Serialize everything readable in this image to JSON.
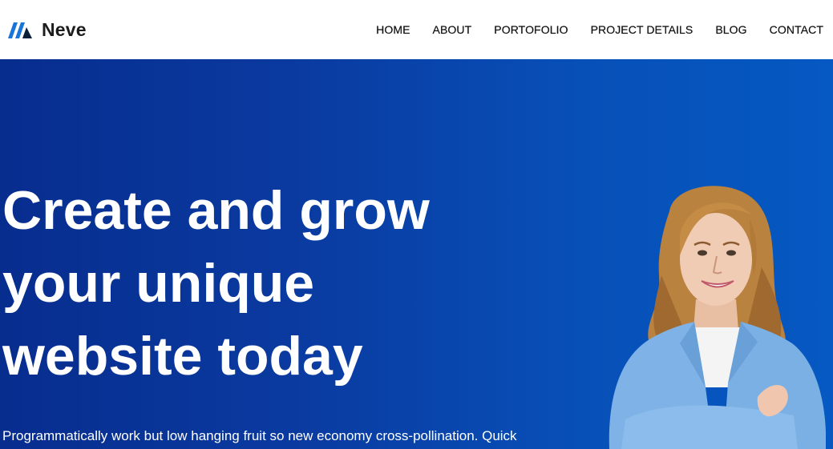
{
  "brand": {
    "name": "Neve",
    "logo_icon": "neve-logo-icon",
    "logo_colors": [
      "#1b74d8",
      "#0b1f3a"
    ]
  },
  "nav": {
    "items": [
      {
        "label": "HOME"
      },
      {
        "label": "ABOUT"
      },
      {
        "label": "PORTOFOLIO"
      },
      {
        "label": "PROJECT DETAILS"
      },
      {
        "label": "BLOG"
      },
      {
        "label": "CONTACT"
      }
    ]
  },
  "hero": {
    "title_lines": [
      "Create and grow",
      "your unique",
      "website today"
    ],
    "text": "Programmatically work but low hanging fruit so new economy cross-pollination. Quick",
    "background_colors": [
      "#072d8e",
      "#0658c2"
    ],
    "photo": "smiling-woman-in-blue-blazer-photo"
  }
}
